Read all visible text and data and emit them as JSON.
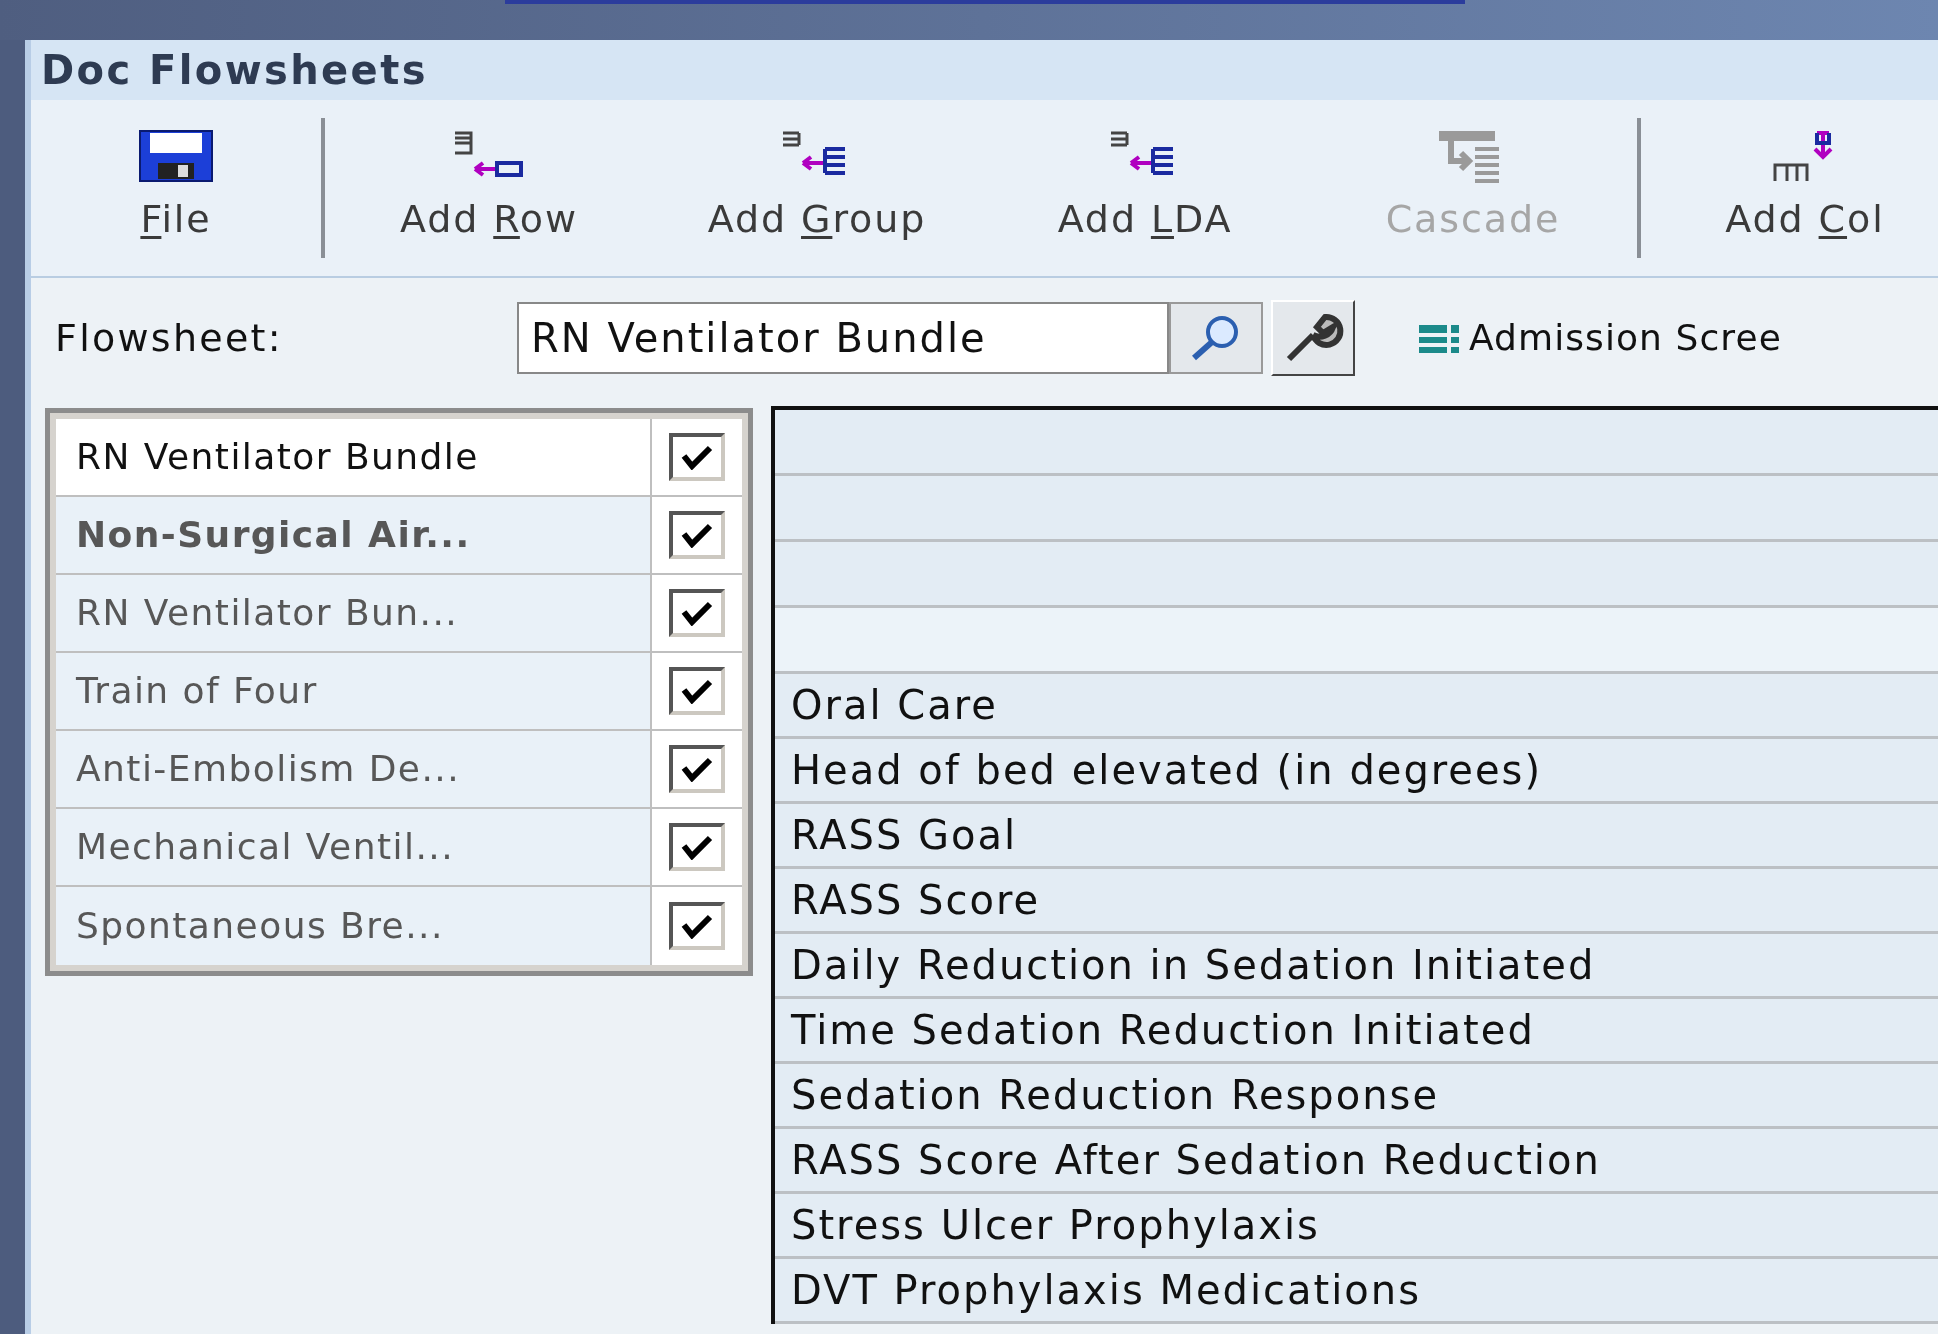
{
  "window": {
    "title": "Doc Flowsheets"
  },
  "toolbar_groups": [
    [
      {
        "kind": "save",
        "key": "F",
        "after": "ile",
        "disabled": false
      }
    ],
    [
      {
        "kind": "add-row",
        "before": "Add ",
        "key": "R",
        "after": "ow",
        "disabled": false
      },
      {
        "kind": "add-group",
        "before": "Add ",
        "key": "G",
        "after": "roup",
        "disabled": false
      },
      {
        "kind": "add-lda",
        "before": "Add ",
        "key": "L",
        "after": "DA",
        "disabled": false
      },
      {
        "kind": "cascade",
        "after": "Cascade",
        "disabled": true
      }
    ],
    [
      {
        "kind": "add-col",
        "before": "Add ",
        "key": "C",
        "after": "ol",
        "disabled": false
      }
    ]
  ],
  "flowsheet": {
    "label": "Flowsheet:",
    "value": "RN Ventilator Bundle",
    "link": "Admission Scree"
  },
  "sections": [
    {
      "label": "RN Ventilator Bundle",
      "selected": true,
      "bold": false,
      "checked": true
    },
    {
      "label": "Non-Surgical Air...",
      "selected": false,
      "bold": true,
      "checked": true
    },
    {
      "label": "RN Ventilator Bun...",
      "selected": false,
      "bold": false,
      "checked": true
    },
    {
      "label": "Train of Four",
      "selected": false,
      "bold": false,
      "checked": true
    },
    {
      "label": "Anti-Embolism De...",
      "selected": false,
      "bold": false,
      "checked": true
    },
    {
      "label": "Mechanical Ventil...",
      "selected": false,
      "bold": false,
      "checked": true
    },
    {
      "label": "Spontaneous Bre...",
      "selected": false,
      "bold": false,
      "checked": true
    }
  ],
  "rows": [
    "Oral Care",
    "Head of bed elevated (in degrees)",
    "RASS Goal",
    "RASS Score",
    "Daily Reduction in Sedation Initiated",
    "Time Sedation Reduction Initiated",
    "Sedation Reduction Response",
    "RASS Score After Sedation Reduction",
    "Stress Ulcer Prophylaxis",
    "DVT Prophylaxis Medications"
  ]
}
